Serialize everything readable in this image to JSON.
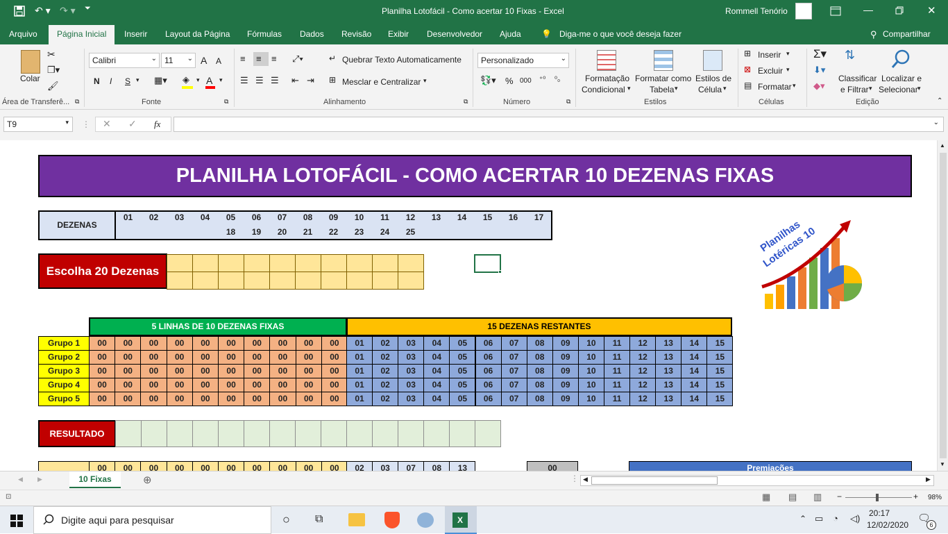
{
  "window": {
    "title": "Planilha Lotofácil - Como acertar 10 Fixas  -  Excel",
    "user": "Rommell Tenório"
  },
  "ribbon_tabs": [
    "Arquivo",
    "Página Inicial",
    "Inserir",
    "Layout da Página",
    "Fórmulas",
    "Dados",
    "Revisão",
    "Exibir",
    "Desenvolvedor",
    "Ajuda"
  ],
  "tell_me": "Diga-me o que você deseja fazer",
  "share": "Compartilhar",
  "clipboard": {
    "paste": "Colar",
    "group": "Área de Transferê..."
  },
  "font": {
    "name": "Calibri",
    "size": "11",
    "bold": "N",
    "italic": "I",
    "underline": "S",
    "group": "Fonte",
    "grow": "A",
    "shrink": "A",
    "color_letter": "A"
  },
  "alignment": {
    "wrap": "Quebrar Texto Automaticamente",
    "merge": "Mesclar e Centralizar",
    "group": "Alinhamento"
  },
  "number": {
    "format": "Personalizado",
    "percent": "%",
    "thousands": "000",
    "group": "Número"
  },
  "styles": {
    "conditional_1": "Formatação",
    "conditional_2": "Condicional",
    "table_1": "Formatar como",
    "table_2": "Tabela",
    "cell_1": "Estilos de",
    "cell_2": "Célula",
    "group": "Estilos"
  },
  "cells": {
    "insert": "Inserir",
    "delete": "Excluir",
    "format": "Formatar",
    "group": "Células"
  },
  "editing": {
    "sort_1": "Classificar",
    "sort_2": "e Filtrar",
    "find_1": "Localizar e",
    "find_2": "Selecionar",
    "group": "Edição"
  },
  "formula_bar": {
    "name_box": "T9",
    "fx": "fx",
    "formula": ""
  },
  "sheet": {
    "title": "PLANILHA LOTOFÁCIL - COMO ACERTAR 10 DEZENAS FIXAS",
    "dezenas_label": "DEZENAS",
    "dezenas_row1": [
      "01",
      "02",
      "03",
      "04",
      "05",
      "06",
      "07",
      "08",
      "09",
      "10",
      "11",
      "12",
      "13",
      "14",
      "15",
      "16",
      "17"
    ],
    "dezenas_row2": [
      "18",
      "19",
      "20",
      "21",
      "22",
      "23",
      "24",
      "25"
    ],
    "escolha_label": "Escolha 20 Dezenas",
    "fixas_header": "5 LINHAS DE 10 DEZENAS FIXAS",
    "restantes_header": "15 DEZENAS RESTANTES",
    "groups": [
      {
        "label": "Grupo 1",
        "fixas": [
          "00",
          "00",
          "00",
          "00",
          "00",
          "00",
          "00",
          "00",
          "00",
          "00"
        ],
        "restantes": [
          "01",
          "02",
          "03",
          "04",
          "05",
          "06",
          "07",
          "08",
          "09",
          "10",
          "11",
          "12",
          "13",
          "14",
          "15"
        ]
      },
      {
        "label": "Grupo 2",
        "fixas": [
          "00",
          "00",
          "00",
          "00",
          "00",
          "00",
          "00",
          "00",
          "00",
          "00"
        ],
        "restantes": [
          "01",
          "02",
          "03",
          "04",
          "05",
          "06",
          "07",
          "08",
          "09",
          "10",
          "11",
          "12",
          "13",
          "14",
          "15"
        ]
      },
      {
        "label": "Grupo 3",
        "fixas": [
          "00",
          "00",
          "00",
          "00",
          "00",
          "00",
          "00",
          "00",
          "00",
          "00"
        ],
        "restantes": [
          "01",
          "02",
          "03",
          "04",
          "05",
          "06",
          "07",
          "08",
          "09",
          "10",
          "11",
          "12",
          "13",
          "14",
          "15"
        ]
      },
      {
        "label": "Grupo 4",
        "fixas": [
          "00",
          "00",
          "00",
          "00",
          "00",
          "00",
          "00",
          "00",
          "00",
          "00"
        ],
        "restantes": [
          "01",
          "02",
          "03",
          "04",
          "05",
          "06",
          "07",
          "08",
          "09",
          "10",
          "11",
          "12",
          "13",
          "14",
          "15"
        ]
      },
      {
        "label": "Grupo 5",
        "fixas": [
          "00",
          "00",
          "00",
          "00",
          "00",
          "00",
          "00",
          "00",
          "00",
          "00"
        ],
        "restantes": [
          "01",
          "02",
          "03",
          "04",
          "05",
          "06",
          "07",
          "08",
          "09",
          "10",
          "11",
          "12",
          "13",
          "14",
          "15"
        ]
      }
    ],
    "resultado_label": "RESULTADO",
    "partial_fixas": [
      "00",
      "00",
      "00",
      "00",
      "00",
      "00",
      "00",
      "00",
      "00",
      "00"
    ],
    "partial_restantes": [
      "02",
      "03",
      "07",
      "08",
      "13"
    ],
    "partial_count": "00",
    "premiacoes_label": "Premiações",
    "logo_line1": "Planilhas",
    "logo_line2": "Lotéricas 10"
  },
  "sheet_tab": "10 Fixas",
  "status": {
    "zoom": "98%"
  },
  "taskbar": {
    "search": "Digite aqui para pesquisar",
    "time": "20:17",
    "date": "12/02/2020",
    "notifications": "6"
  },
  "colors": {
    "excel_green": "#217346",
    "banner_purple": "#7030a0",
    "fixas_green": "#00b050",
    "restantes_gold": "#ffc000",
    "group_yellow": "#ffff00",
    "fixas_salmon": "#f4b183",
    "restantes_blue": "#8ea9db",
    "escolha_red": "#c00000"
  }
}
